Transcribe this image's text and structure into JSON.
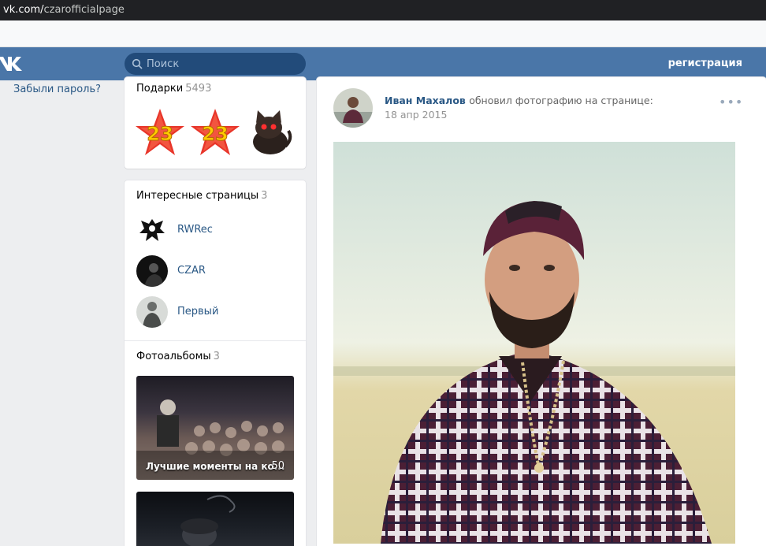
{
  "browser": {
    "url_domain": "vk.com/",
    "url_path": "czarofficialpage"
  },
  "header": {
    "search_placeholder": "Поиск",
    "register_label": "регистрация"
  },
  "sidebar": {
    "forgot_password": "Забыли пароль?"
  },
  "gifts": {
    "title": "Подарки",
    "count": "5493",
    "items": [
      "star-23-icon",
      "star-23-icon",
      "black-cat-icon"
    ]
  },
  "interesting_pages": {
    "title": "Интересные страницы",
    "count": "3",
    "items": [
      {
        "name": "RWRec"
      },
      {
        "name": "CZAR"
      },
      {
        "name": "Первый"
      }
    ]
  },
  "albums": {
    "title": "Фотоальбомы",
    "count": "3",
    "items": [
      {
        "title": "Лучшие моменты на ко...",
        "count": "50"
      }
    ]
  },
  "post": {
    "author": "Иван Махалов",
    "action": "обновил фотографию на странице:",
    "date": "18 апр 2015",
    "menu": "•••"
  },
  "colors": {
    "header_bg": "#4a76a8",
    "link": "#2a5885",
    "page_bg": "#edeef0"
  }
}
